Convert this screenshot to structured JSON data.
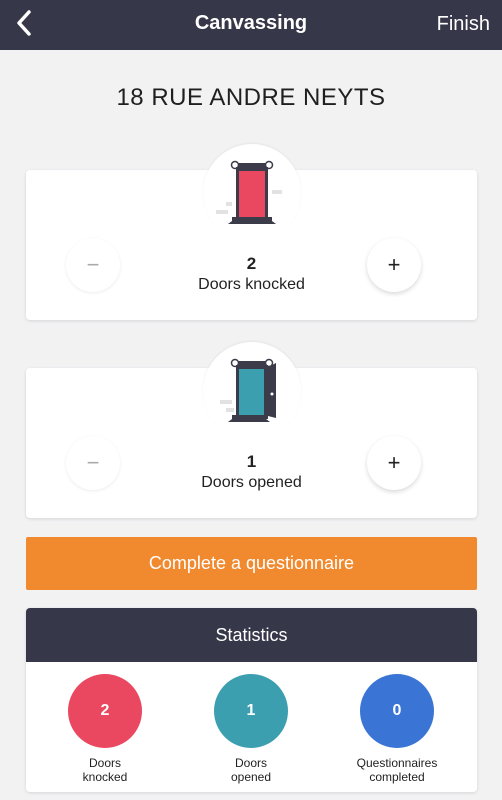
{
  "header": {
    "title": "Canvassing",
    "finish_label": "Finish"
  },
  "address": "18 RUE ANDRE NEYTS",
  "doors_knocked": {
    "count": "2",
    "label": "Doors knocked"
  },
  "doors_opened": {
    "count": "1",
    "label": "Doors opened"
  },
  "questionnaire_button": "Complete a questionnaire",
  "statistics": {
    "title": "Statistics",
    "items": [
      {
        "value": "2",
        "label_line1": "Doors",
        "label_line2": "knocked",
        "color": "#ea4761"
      },
      {
        "value": "1",
        "label_line1": "Doors",
        "label_line2": "opened",
        "color": "#3c9fb0"
      },
      {
        "value": "0",
        "label_line1": "Questionnaires",
        "label_line2": "completed",
        "color": "#3a75d5"
      }
    ]
  },
  "colors": {
    "header_bg": "#363749",
    "accent_orange": "#f18a2f",
    "door_closed": "#ea4761",
    "door_open": "#3c9fb0"
  }
}
